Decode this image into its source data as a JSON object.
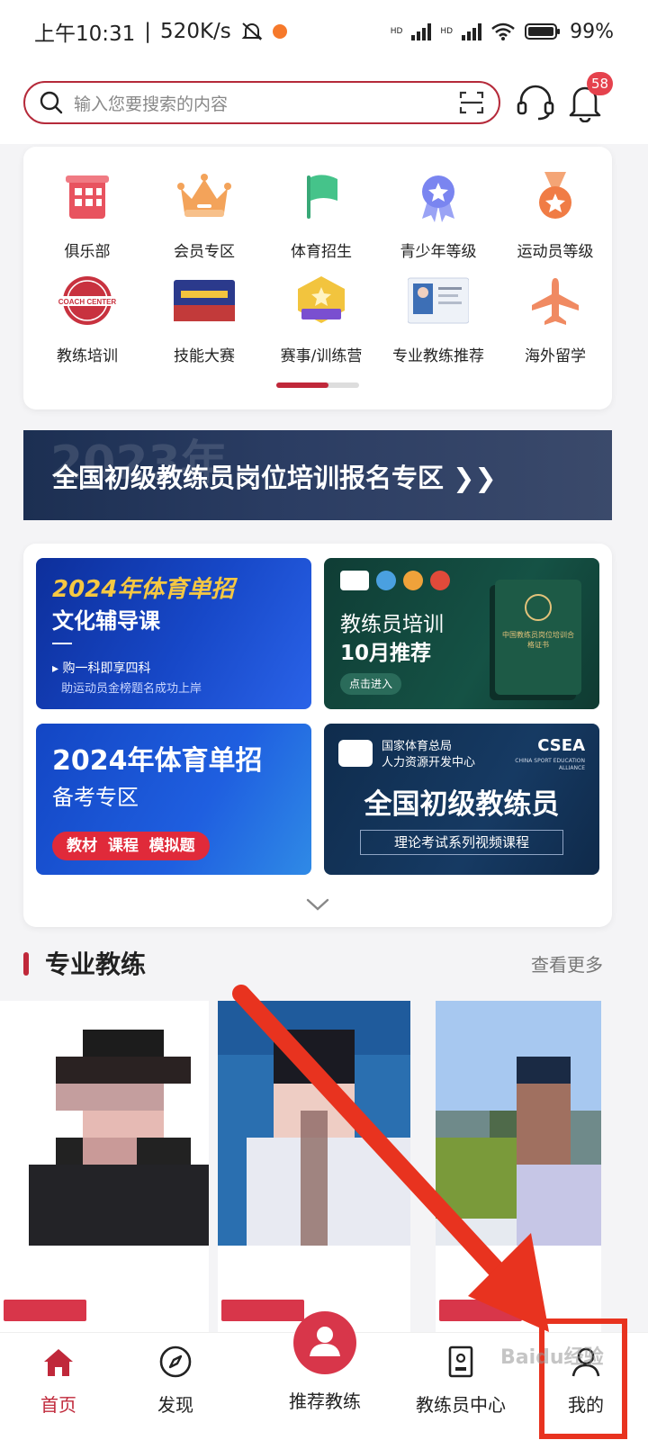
{
  "status_bar": {
    "time": "上午10:31",
    "speed": "520K/s",
    "hd1": "HD",
    "hd2": "HD",
    "battery": "99%"
  },
  "header": {
    "search_placeholder": "输入您要搜索的内容",
    "notification_count": "58"
  },
  "categories": [
    {
      "label": "俱乐部",
      "icon": "building-icon",
      "color": "#e8535f"
    },
    {
      "label": "会员专区",
      "icon": "crown-icon",
      "color": "#f3a35a"
    },
    {
      "label": "体育招生",
      "icon": "flag-icon",
      "color": "#45c38a"
    },
    {
      "label": "青少年等级",
      "icon": "badge-icon",
      "color": "#7a85f0"
    },
    {
      "label": "运动员等级",
      "icon": "medal-icon",
      "color": "#f07c45"
    },
    {
      "label": "教练培训",
      "icon": "coach-center-seal-icon",
      "color": "#c8323f"
    },
    {
      "label": "技能大赛",
      "icon": "competition-poster-icon",
      "color": "#2b3a8c"
    },
    {
      "label": "赛事/训练营",
      "icon": "training-camp-badge-icon",
      "color": "#f2c43e"
    },
    {
      "label": "专业教练推荐",
      "icon": "coach-profile-card-icon",
      "color": "#3d6fb6"
    },
    {
      "label": "海外留学",
      "icon": "airplane-icon",
      "color": "#f08a62"
    }
  ],
  "banner": {
    "ghost_text": "2023年",
    "title": "全国初级教练员岗位培训报名专区 ❯❯"
  },
  "promos": [
    {
      "title": "2024年体育单招",
      "subtitle": "文化辅导课",
      "bullet": "购一科即享四科",
      "note": "助运动员金榜题名成功上岸"
    },
    {
      "title": "教练员培训",
      "subtitle": "10月推荐",
      "button": "点击进入",
      "book": "中国教练员岗位培训合格证书"
    },
    {
      "title": "2024年体育单招",
      "subtitle": "备考专区",
      "tags": "教材  课程  模拟题"
    },
    {
      "org_line1": "国家体育总局",
      "org_line2": "人力资源开发中心",
      "brand": "CSEA",
      "brand_sub": "CHINA SPORT EDUCATION ALLIANCE",
      "title": "全国初级教练员",
      "subtitle": "理论考试系列视频课程"
    }
  ],
  "coaches_section": {
    "title": "专业教练",
    "more": "查看更多"
  },
  "bottom_nav": [
    {
      "label": "首页",
      "icon": "home-icon",
      "active": true
    },
    {
      "label": "发现",
      "icon": "compass-icon",
      "active": false
    },
    {
      "label": "推荐教练",
      "icon": "coach-icon",
      "active": false
    },
    {
      "label": "教练员中心",
      "icon": "id-badge-icon",
      "active": false
    },
    {
      "label": "我的",
      "icon": "user-icon",
      "active": false
    }
  ],
  "colors": {
    "accent": "#c0283a",
    "annotation": "#e8331f"
  },
  "watermark": "Baidu经验"
}
